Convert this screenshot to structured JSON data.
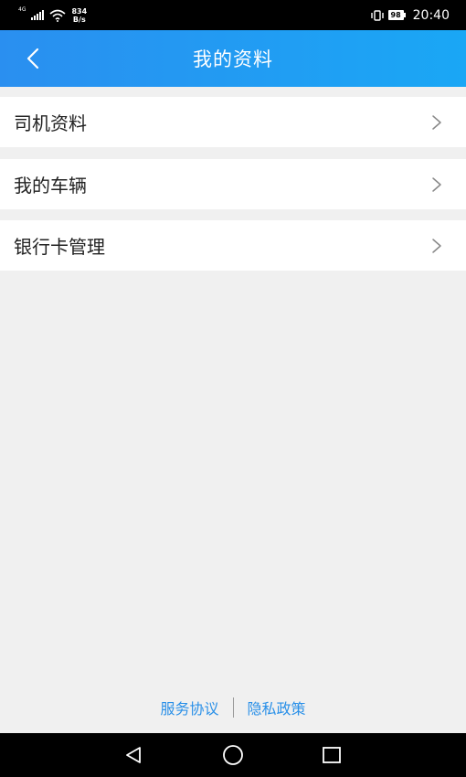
{
  "status_bar": {
    "network_type": "4G",
    "speed_value": "834",
    "speed_unit": "B/s",
    "battery": "98",
    "time": "20:40"
  },
  "header": {
    "title": "我的资料",
    "back_icon": "chevron-left-icon"
  },
  "menu": {
    "items": [
      {
        "label": "司机资料",
        "icon": "chevron-right-icon"
      },
      {
        "label": "我的车辆",
        "icon": "chevron-right-icon"
      },
      {
        "label": "银行卡管理",
        "icon": "chevron-right-icon"
      }
    ]
  },
  "footer": {
    "service_agreement": "服务协议",
    "privacy_policy": "隐私政策"
  },
  "colors": {
    "header_start": "#2a8ff0",
    "header_end": "#1aa7f5",
    "link": "#2a90e8",
    "background": "#f0f0f0"
  }
}
